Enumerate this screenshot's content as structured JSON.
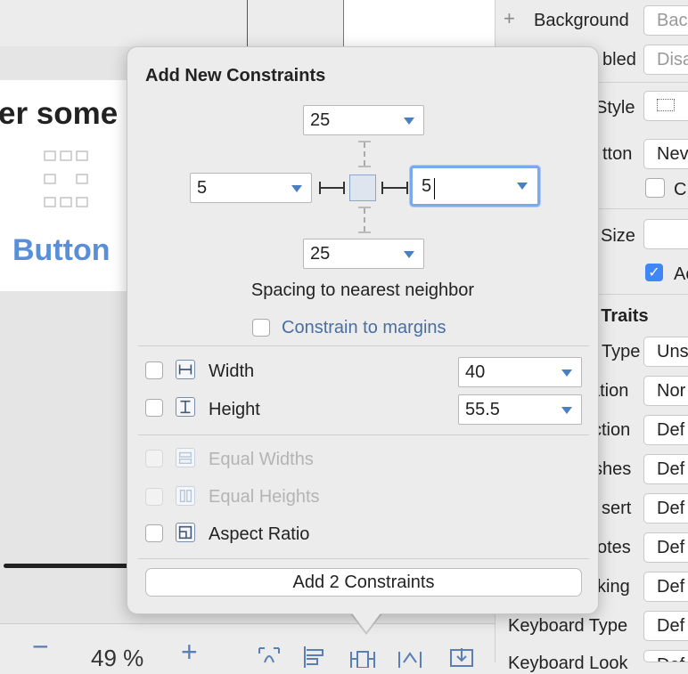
{
  "canvas": {
    "view_title": "er some",
    "button_text": "Button",
    "zoom_out": "−",
    "zoom_level": "49 %",
    "zoom_in": "+"
  },
  "inspector": {
    "add_symbol": "+",
    "background_label": "Background",
    "background_value": "Back",
    "disabled_label": "bled",
    "disabled_value": "Disa",
    "style_label": "Style",
    "button_label": "tton",
    "button_value": "Nev",
    "checkbox_c_label": "C",
    "size_label": "Size",
    "checkbox_a_label": "Ac",
    "traits_heading": "t Traits",
    "type_label": "Type",
    "type_value": "Uns",
    "ation_label": "ation",
    "ation_value": "Nor",
    "ction_label": "ction",
    "ction_value": "Def",
    "shes_label": "shes",
    "shes_value": "Def",
    "sert_label": "sert",
    "sert_value": "Def",
    "otes_label": "otes",
    "otes_value": "Def",
    "king_label": "king",
    "king_value": "Def",
    "keyboard_type_label": "Keyboard Type",
    "keyboard_type_value": "Def",
    "keyboard_look_label": "Keyboard Look",
    "keyboard_look_value": "Def"
  },
  "popover": {
    "title": "Add New Constraints",
    "top_value": "25",
    "left_value": "5",
    "right_value": "5",
    "bottom_value": "25",
    "spacing_label": "Spacing to nearest neighbor",
    "constrain_label": "Constrain to margins",
    "width_label": "Width",
    "width_value": "40",
    "height_label": "Height",
    "height_value": "55.5",
    "equal_widths_label": "Equal Widths",
    "equal_heights_label": "Equal Heights",
    "aspect_ratio_label": "Aspect Ratio",
    "add_button_label": "Add 2 Constraints"
  }
}
